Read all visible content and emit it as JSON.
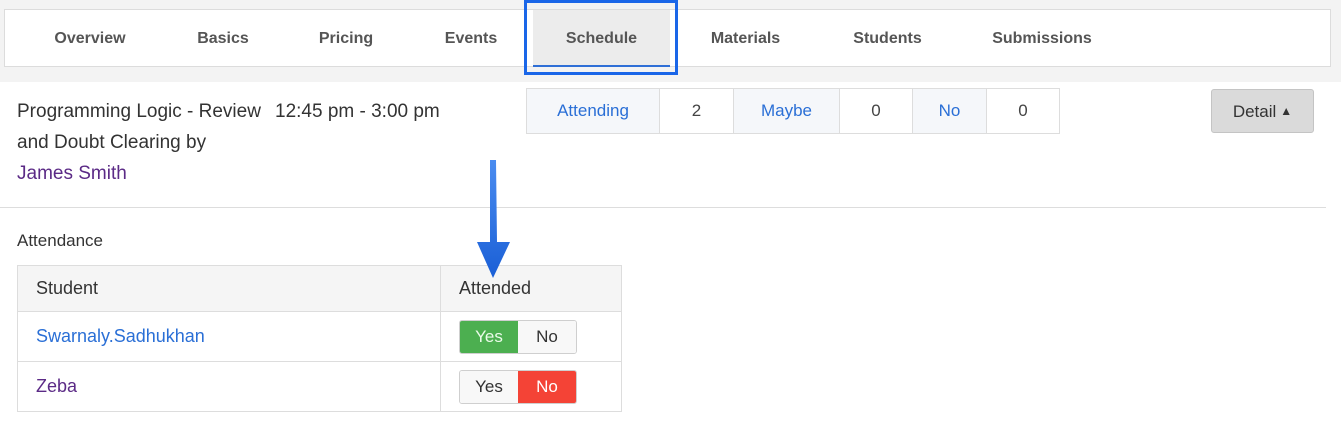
{
  "tabs": [
    {
      "label": "Overview",
      "active": false
    },
    {
      "label": "Basics",
      "active": false
    },
    {
      "label": "Pricing",
      "active": false
    },
    {
      "label": "Events",
      "active": false
    },
    {
      "label": "Schedule",
      "active": true
    },
    {
      "label": "Materials",
      "active": false
    },
    {
      "label": "Students",
      "active": false
    },
    {
      "label": "Submissions",
      "active": false
    }
  ],
  "event": {
    "title": "Programming Logic - Review and Doubt Clearing by",
    "time": "12:45 pm - 3:00 pm",
    "host": "James Smith"
  },
  "rsvp": {
    "attending_label": "Attending",
    "attending_count": "2",
    "maybe_label": "Maybe",
    "maybe_count": "0",
    "no_label": "No",
    "no_count": "0"
  },
  "detail_button": {
    "label": "Detail",
    "icon": "chevron-up-icon"
  },
  "attendance": {
    "heading": "Attendance",
    "columns": [
      "Student",
      "Attended"
    ],
    "rows": [
      {
        "student": "Swarnaly.Sadhukhan",
        "attended": "Yes",
        "yes_label": "Yes",
        "no_label": "No"
      },
      {
        "student": "Zeba",
        "attended": "No",
        "yes_label": "Yes",
        "no_label": "No"
      }
    ]
  },
  "colors": {
    "accent": "#2a6fd6",
    "highlight_box": "#1a66e8",
    "yes_active": "#4caf50",
    "no_active": "#f44336",
    "visited_link": "#5b2a86"
  },
  "annotation": {
    "icon": "down-arrow-icon"
  }
}
